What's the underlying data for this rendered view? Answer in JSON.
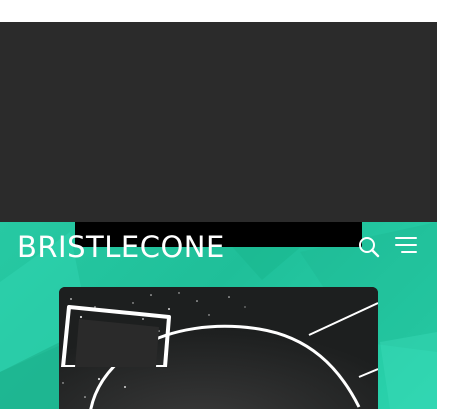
{
  "header": {
    "logo_text": "BRISTLECONE",
    "search_icon": "search-icon",
    "menu_icon": "hamburger-menu-icon"
  },
  "hero": {
    "video_icon": "play-icon"
  },
  "colors": {
    "accent": "#27c9a3",
    "dark_panel": "#2b2b2b",
    "video_bg": "#1d1f1f"
  }
}
